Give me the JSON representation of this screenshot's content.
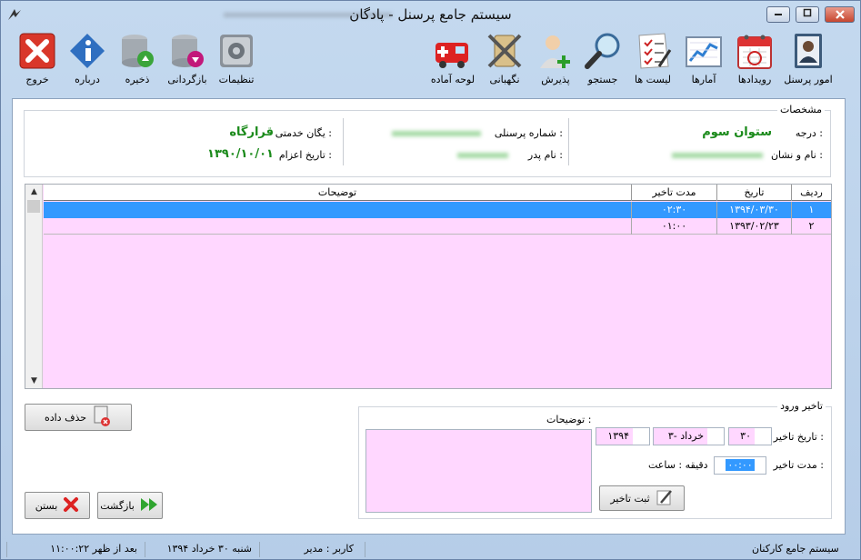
{
  "window": {
    "title": "سیستم جامع پرسنل - پادگان",
    "controls": {
      "minimize": "▭",
      "maximize": "▫",
      "close": "✕"
    }
  },
  "toolbar": {
    "items": [
      {
        "label": "امور پرسنل",
        "icon": "personnel-icon"
      },
      {
        "label": "رویدادها",
        "icon": "calendar-icon"
      },
      {
        "label": "آمارها",
        "icon": "chart-icon"
      },
      {
        "label": "لیست ها",
        "icon": "checklist-icon"
      },
      {
        "label": "جستجو",
        "icon": "search-icon"
      },
      {
        "label": "پذیرش",
        "icon": "add-user-icon"
      },
      {
        "label": "نگهبانی",
        "icon": "swords-icon"
      },
      {
        "label": "لوحه آماده",
        "icon": "ambulance-icon"
      },
      {
        "label": "تنظیمات",
        "icon": "settings-icon"
      },
      {
        "label": "بازگردانی",
        "icon": "restore-db-icon"
      },
      {
        "label": "ذخیره",
        "icon": "save-db-icon"
      },
      {
        "label": "درباره",
        "icon": "info-icon"
      },
      {
        "label": "خروج",
        "icon": "exit-icon"
      }
    ]
  },
  "info": {
    "caption": "مشخصات",
    "rank_label": "درجه :",
    "rank_value": "ستوان سوم",
    "name_label": "نام و نشان :",
    "personnel_no_label": "شماره پرسنلی :",
    "father_label": "نام پدر :",
    "unit_label": "یگان خدمتی :",
    "unit_value": "قرارگاه",
    "dispatch_label": "تاریخ اعزام :",
    "dispatch_value": "۱۳۹۰/۱۰/۰۱"
  },
  "grid": {
    "columns": [
      "ردیف",
      "تاریخ",
      "مدت تاخیر",
      "توضیحات"
    ],
    "rows": [
      {
        "no": "۱",
        "date": "۱۳۹۴/۰۳/۳۰",
        "delay": "۰۲:۳۰",
        "desc": ""
      },
      {
        "no": "۲",
        "date": "۱۳۹۳/۰۲/۲۳",
        "delay": "۰۱:۰۰",
        "desc": ""
      }
    ]
  },
  "actions": {
    "delete_label": "حذف داده",
    "back_label": "بازگشت",
    "close_label": "بستن"
  },
  "delay_form": {
    "caption": "تاخیر ورود",
    "date_label": "تاریخ تاخیر :",
    "day_value": "۳۰",
    "month_value": "۳- خرداد",
    "year_value": "۱۳۹۴",
    "duration_label": "مدت تاخیر :",
    "duration_value": "۰۰:۰۰",
    "duration_hint": "دقیقه : ساعت",
    "desc_label": "توضیحات :",
    "submit_label": "ثبت تاخیر"
  },
  "status": {
    "system": "سیستم جامع کارکنان",
    "user": "کاربر : مدیر",
    "date": "شنبه ۳۰ خرداد ۱۳۹۴",
    "time": "۱۱:۰۰:۲۲ بعد از ظهر"
  }
}
